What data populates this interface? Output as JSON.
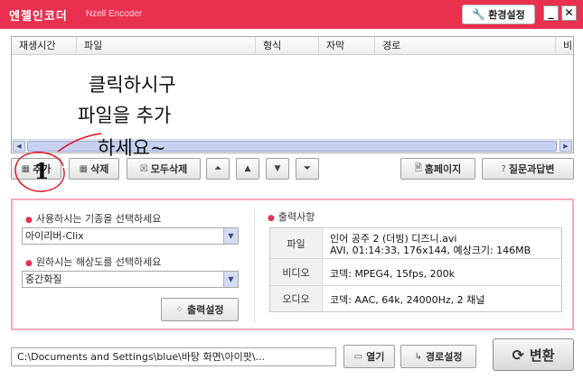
{
  "window": {
    "title": "엔젤인코더",
    "subtitle": "Nzell Encoder",
    "settings_label": "환경설정",
    "minimize_symbol": "_",
    "close_symbol": "✕"
  },
  "file_list": {
    "columns": [
      "재생시간",
      "파일",
      "형식",
      "자막",
      "경로",
      "비"
    ]
  },
  "annotation": {
    "lines": [
      "클릭하시구",
      "파일을 추가",
      "하세요~"
    ],
    "number": "1",
    "color": "#e01020"
  },
  "toolbar": {
    "add_label": "추가",
    "delete_label": "삭제",
    "delete_all_label": "모두삭제",
    "homepage_label": "홈페이지",
    "faq_label": "질문과답변"
  },
  "settings_panel": {
    "device_label": "사용하시는 기종을 선택하세요",
    "device_value": "아이리버-Clix",
    "resolution_label": "원하시는 해상도를 선택하세요",
    "resolution_value": "중간화질",
    "output_settings_label": "출력설정"
  },
  "output_info": {
    "heading": "출력사항",
    "rows": [
      {
        "key": "파일",
        "lines": [
          "인어 공주 2 (더빙) 디즈니.avi",
          "AVI, 01:14:33, 176x144, 예상크기: 146MB"
        ]
      },
      {
        "key": "비디오",
        "lines": [
          "코덱: MPEG4, 15fps, 200k"
        ]
      },
      {
        "key": "오디오",
        "lines": [
          "코덱: AAC, 64k, 24000Hz, 2 채널"
        ]
      }
    ]
  },
  "footer": {
    "output_path": "C:\\Documents and Settings\\blue\\바탕 화면\\아이팟\\...",
    "open_label": "열기",
    "path_settings_label": "경로설정",
    "convert_label": "변환"
  },
  "colors": {
    "accent": "#e9304f",
    "panel_border": "#f5a9b8"
  },
  "icons": {
    "settings": "wrench-icon",
    "add": "film-icon",
    "delete": "film-delete-icon",
    "delete_all": "checkbox-x-icon",
    "move_top": "double-chevron-up-icon",
    "move_up": "chevron-up-icon",
    "move_down": "chevron-down-icon",
    "move_bottom": "double-chevron-down-icon",
    "homepage": "document-icon",
    "faq": "question-icon",
    "output_settings": "settings-dots-icon",
    "open": "folder-icon",
    "path_settings": "path-icon",
    "convert": "refresh-icon"
  }
}
